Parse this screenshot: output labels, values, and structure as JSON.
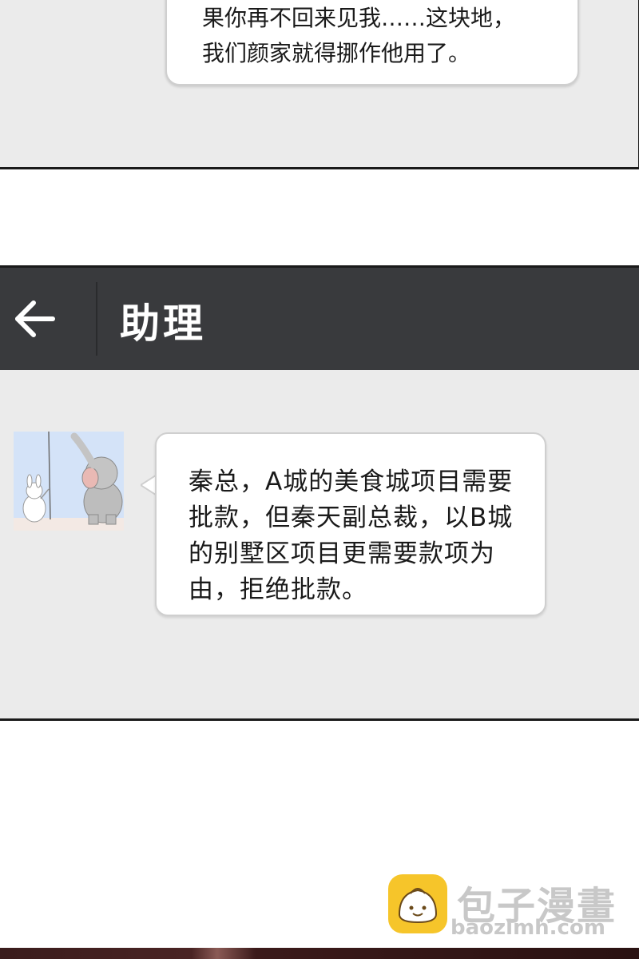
{
  "top_panel": {
    "bubble_lines": [
      "果你再不回来见我……这块地，",
      "我们颜家就得挪作他用了。"
    ]
  },
  "chat": {
    "back_icon": "arrow-left-icon",
    "title": "助理",
    "header_color": "#393a3d",
    "background_color": "#ebebeb",
    "avatar": "elephant-and-rabbit-avatar",
    "message_lines": [
      "秦总，A城的美食城项目需要",
      "批款，但秦天副总裁，以B城",
      "的别墅区项目更需要款项为",
      "由，拒绝批款。"
    ]
  },
  "watermark": {
    "icon": "bun-logo-icon",
    "title": "包子漫畫",
    "url": "baozimh.com"
  }
}
